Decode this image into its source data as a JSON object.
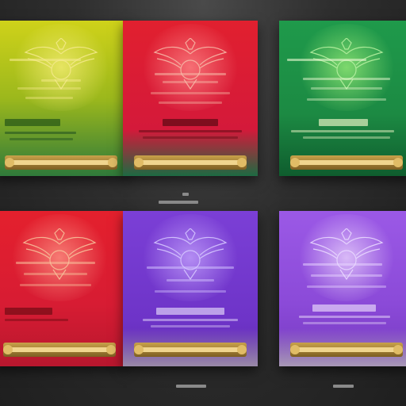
{
  "cards": [
    {
      "id": "yellow-green",
      "top_color": "#cfd21a",
      "mid_color": "#8dab1c",
      "bottom_color": "#2f7a3a",
      "accent": "#f4e98a"
    },
    {
      "id": "red-top",
      "top_color": "#e1202f",
      "mid_color": "#d4193a",
      "bottom_color": "#1d6a42",
      "accent": "#f6b8a6"
    },
    {
      "id": "green",
      "top_color": "#1f9a4b",
      "mid_color": "#1c8a43",
      "bottom_color": "#0f5d2e",
      "accent": "#b6f0a0"
    },
    {
      "id": "red-bottom",
      "top_color": "#e4202d",
      "mid_color": "#d71c33",
      "bottom_color": "#b7172e",
      "accent": "#f7c09a"
    },
    {
      "id": "purple",
      "top_color": "#7b3fd6",
      "mid_color": "#6e34c8",
      "bottom_color": "#5f2ab0",
      "accent": "#d6c7ff"
    },
    {
      "id": "violet",
      "top_color": "#9b59e6",
      "mid_color": "#8b4ad8",
      "bottom_color": "#7438bf",
      "accent": "#e9d8ff"
    }
  ],
  "gold": "#d9b25a",
  "gold_dark": "#8c6a28"
}
